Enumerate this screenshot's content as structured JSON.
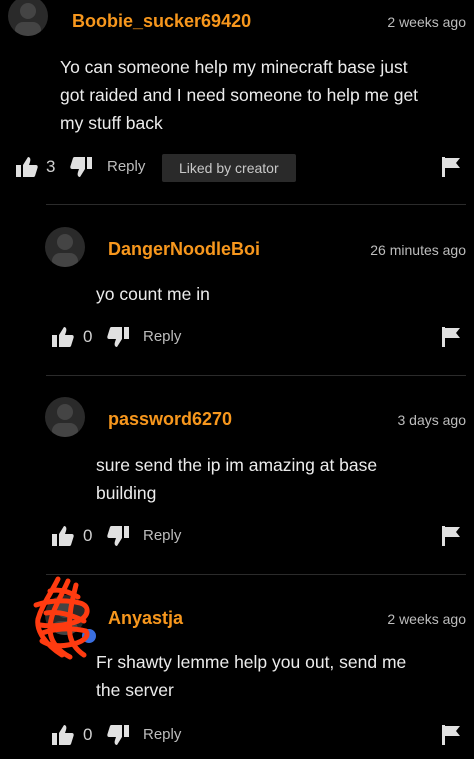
{
  "comments": [
    {
      "username": "Boobie_sucker69420",
      "time": "2 weeks ago",
      "lines": [
        "Yo can someone help my minecraft base just",
        "got raided and I need someone to help me get",
        "my stuff back"
      ],
      "likes": "3",
      "reply_label": "Reply",
      "liked_by_creator": "Liked by creator"
    },
    {
      "username": "DangerNoodleBoi",
      "time": "26 minutes ago",
      "lines": [
        "yo count me in"
      ],
      "likes": "0",
      "reply_label": "Reply"
    },
    {
      "username": "password6270",
      "time": "3 days ago",
      "lines": [
        "sure send the ip im amazing at base",
        "building"
      ],
      "likes": "0",
      "reply_label": "Reply"
    },
    {
      "username": "Anyastja",
      "time": "2 weeks ago",
      "lines": [
        "Fr shawty lemme help you out, send me",
        "the server"
      ],
      "likes": "0",
      "reply_label": "Reply"
    }
  ],
  "colors": {
    "accent": "#f7971d",
    "background": "#000000",
    "chip": "#2a2a2a"
  }
}
